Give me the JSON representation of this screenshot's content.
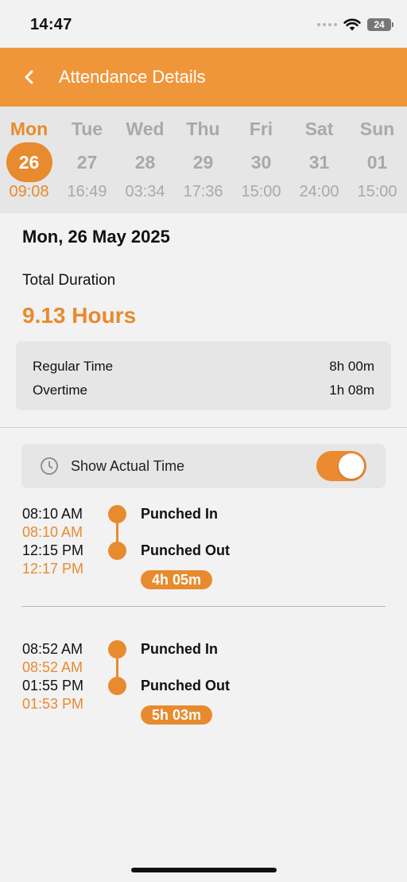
{
  "status_bar": {
    "time": "14:47",
    "battery": "24"
  },
  "header": {
    "title": "Attendance Details"
  },
  "week": [
    {
      "day": "Mon",
      "date": "26",
      "hours": "09:08",
      "active": true
    },
    {
      "day": "Tue",
      "date": "27",
      "hours": "16:49",
      "active": false
    },
    {
      "day": "Wed",
      "date": "28",
      "hours": "03:34",
      "active": false
    },
    {
      "day": "Thu",
      "date": "29",
      "hours": "17:36",
      "active": false
    },
    {
      "day": "Fri",
      "date": "30",
      "hours": "15:00",
      "active": false
    },
    {
      "day": "Sat",
      "date": "31",
      "hours": "24:00",
      "active": false
    },
    {
      "day": "Sun",
      "date": "01",
      "hours": "15:00",
      "active": false
    }
  ],
  "details": {
    "date_title": "Mon, 26 May 2025",
    "total_label": "Total Duration",
    "total_value": "9.13 Hours",
    "regular_label": "Regular Time",
    "regular_value": "8h 00m",
    "overtime_label": "Overtime",
    "overtime_value": "1h 08m"
  },
  "toggle": {
    "label": "Show Actual Time",
    "on": true
  },
  "punches": [
    {
      "in_time": "08:10 AM",
      "in_actual": "08:10 AM",
      "out_time": "12:15 PM",
      "out_actual": "12:17 PM",
      "in_label": "Punched In",
      "out_label": "Punched Out",
      "duration": "4h 05m"
    },
    {
      "in_time": "08:52 AM",
      "in_actual": "08:52 AM",
      "out_time": "01:55 PM",
      "out_actual": "01:53 PM",
      "in_label": "Punched In",
      "out_label": "Punched Out",
      "duration": "5h 03m"
    }
  ],
  "colors": {
    "accent": "#f0963a",
    "accent_dark": "#e88a2e",
    "background": "#f2f2f2",
    "card": "#e6e6e6"
  }
}
